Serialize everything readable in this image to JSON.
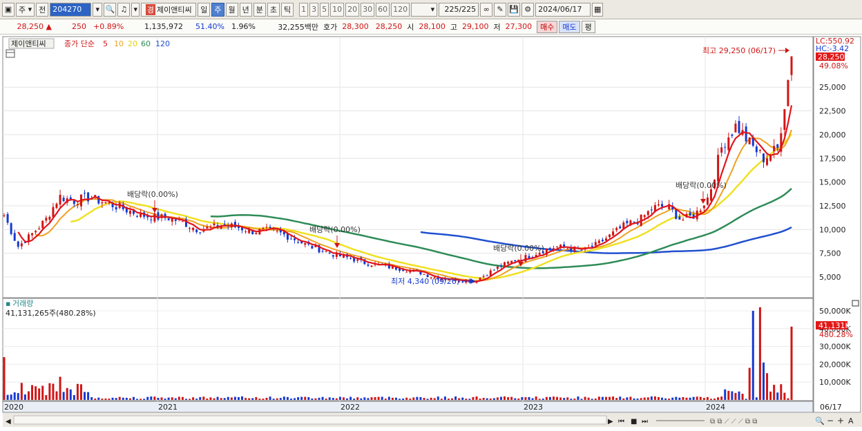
{
  "toolbar": {
    "market": "주",
    "prev_label": "전",
    "code": "204270",
    "badge": "경",
    "name": "제이앤티씨",
    "periods": [
      "일",
      "주",
      "월",
      "년",
      "분",
      "초",
      "틱"
    ],
    "active_period": "주",
    "intervals": [
      "1",
      "3",
      "5",
      "10",
      "20",
      "30",
      "60",
      "120"
    ],
    "count": "225",
    "count_total": "/225",
    "date": "2024/06/17"
  },
  "quote": {
    "price": "28,250",
    "change": "250",
    "change_pct": "+0.89%",
    "volume": "1,135,972",
    "ratio": "51.40%",
    "turnover": "1.96%",
    "amount": "32,255백만",
    "ask_label": "호가",
    "ask1": "28,300",
    "ask2": "28,250",
    "open_label": "시",
    "open": "28,100",
    "high_label": "고",
    "high": "29,100",
    "low_label": "저",
    "low": "27,300",
    "buy_label": "매수",
    "sell_label": "매도",
    "eval_label": "평"
  },
  "legend": {
    "stock_name": "제이앤티씨",
    "ma_label": "종가 단순",
    "ma_periods": [
      "5",
      "10",
      "20",
      "60",
      "120"
    ]
  },
  "annotations": {
    "high": "최고 29,250 (06/17)",
    "low": "최저 4,340 (09/26)",
    "dividend": "배당락(0.00%)",
    "lc": "LC:550.92",
    "hc": "HC:-3.42",
    "price_tag": "28,250",
    "pct_tag": "49.08%"
  },
  "volume_panel": {
    "title": "거래량",
    "info": "41,131,265주(480.28%)",
    "tag_value": "41,131K",
    "tag_pct": "480.28%"
  },
  "colors": {
    "up": "#d01515",
    "down": "#1539d0",
    "ma5": "#e0141c",
    "ma10": "#f0a020",
    "ma20": "#f0e020",
    "ma60": "#2e8b57",
    "ma120": "#2050d0"
  },
  "chart_data": {
    "type": "candlestick",
    "price_axis": {
      "ticks": [
        "5,000",
        "7,500",
        "10,000",
        "12,500",
        "15,000",
        "17,500",
        "20,000",
        "22,500",
        "25,000"
      ],
      "values": [
        5000,
        7500,
        10000,
        12500,
        15000,
        17500,
        20000,
        22500,
        25000
      ]
    },
    "volume_axis": {
      "ticks": [
        "10,000K",
        "20,000K",
        "30,000K",
        "40,000K",
        "50,000K"
      ],
      "values": [
        10000,
        20000,
        30000,
        40000,
        50000
      ]
    },
    "x_labels": [
      "2020",
      "2021",
      "2022",
      "2023",
      "2024",
      "06/17"
    ],
    "close_path": [
      [
        "2020-01",
        11500
      ],
      [
        "2020-02",
        8200
      ],
      [
        "2020-03",
        9500
      ],
      [
        "2020-04",
        11000
      ],
      [
        "2020-05",
        13500
      ],
      [
        "2020-06",
        13000
      ],
      [
        "2020-07",
        13400
      ],
      [
        "2020-08",
        13000
      ],
      [
        "2020-09",
        12500
      ],
      [
        "2020-10",
        12000
      ],
      [
        "2020-11",
        11500
      ],
      [
        "2020-12",
        11300
      ],
      [
        "2021-02",
        11200
      ],
      [
        "2021-03",
        10700
      ],
      [
        "2021-04",
        10000
      ],
      [
        "2021-05",
        10200
      ],
      [
        "2021-06",
        10500
      ],
      [
        "2021-07",
        10200
      ],
      [
        "2021-08",
        9800
      ],
      [
        "2021-09",
        9900
      ],
      [
        "2021-10",
        9600
      ],
      [
        "2021-11",
        9000
      ],
      [
        "2021-12",
        8300
      ],
      [
        "2022-01",
        7800
      ],
      [
        "2022-02",
        7300
      ],
      [
        "2022-03",
        7000
      ],
      [
        "2022-04",
        6500
      ],
      [
        "2022-05",
        6300
      ],
      [
        "2022-06",
        6000
      ],
      [
        "2022-07",
        5800
      ],
      [
        "2022-08",
        5500
      ],
      [
        "2022-09",
        5000
      ],
      [
        "2022-10",
        4800
      ],
      [
        "2022-11",
        4700
      ],
      [
        "2022-12",
        4500
      ],
      [
        "2023-01",
        5400
      ],
      [
        "2023-02",
        6200
      ],
      [
        "2023-03",
        6800
      ],
      [
        "2023-04",
        7200
      ],
      [
        "2023-05",
        7800
      ],
      [
        "2023-06",
        8200
      ],
      [
        "2023-07",
        8000
      ],
      [
        "2023-08",
        7800
      ],
      [
        "2023-09",
        8500
      ],
      [
        "2023-10",
        9500
      ],
      [
        "2023-11",
        10500
      ],
      [
        "2023-12",
        11000
      ],
      [
        "2024-01",
        12300
      ],
      [
        "2024-02",
        12500
      ],
      [
        "2024-03",
        11000
      ],
      [
        "2024-04",
        11500
      ],
      [
        "2024-05",
        13500
      ],
      [
        "2024-06",
        19000
      ],
      [
        "2024-07",
        21000
      ],
      [
        "2024-08",
        19000
      ],
      [
        "2024-09",
        17500
      ],
      [
        "2024-10",
        18500
      ],
      [
        "2024-11",
        28250
      ]
    ]
  }
}
